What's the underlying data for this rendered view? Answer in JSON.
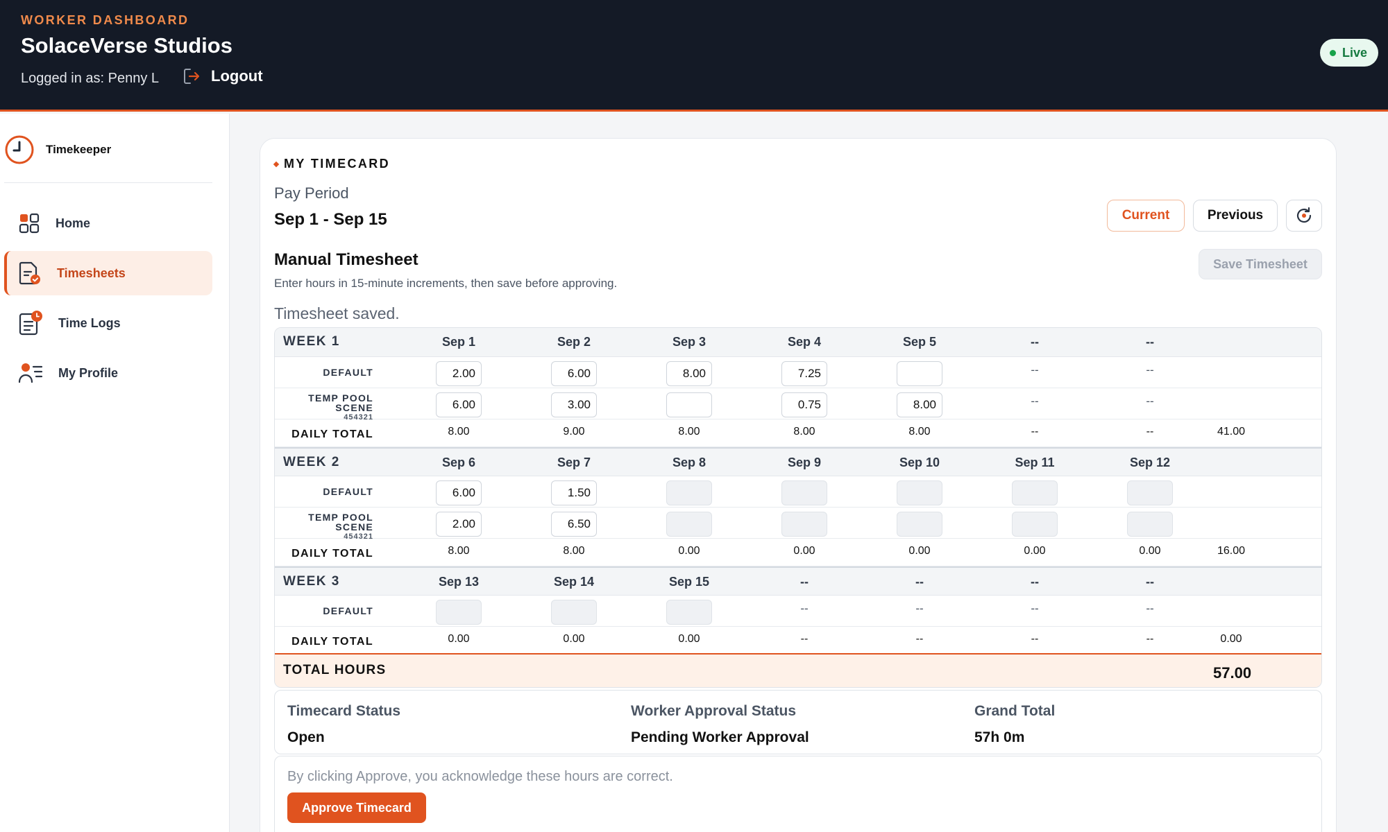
{
  "header": {
    "eyebrow": "WORKER DASHBOARD",
    "title": "SolaceVerse Studios",
    "user_line": "Logged in as: Penny L",
    "logout_label": "Logout",
    "live_label": "Live",
    "colors": {
      "background": "#141a26",
      "accent": "#e0531f",
      "live": "#16a34a"
    }
  },
  "sidebar": {
    "brand": "Timekeeper",
    "items": [
      {
        "label": "Home",
        "icon": "grid-icon",
        "active": false
      },
      {
        "label": "Timesheets",
        "icon": "document-check-icon",
        "active": true
      },
      {
        "label": "Time Logs",
        "icon": "log-clock-icon",
        "active": false
      },
      {
        "label": "My Profile",
        "icon": "user-list-icon",
        "active": false
      }
    ]
  },
  "timecard": {
    "section_label": "MY TIMECARD",
    "pay_period_label": "Pay Period",
    "pay_period_value": "Sep 1 - Sep 15",
    "btn_current": "Current",
    "btn_previous": "Previous",
    "refresh_icon": "refresh-icon",
    "manual_title": "Manual Timesheet",
    "manual_subtitle": "Enter hours in 15-minute increments, then save before approving.",
    "save_label": "Save Timesheet",
    "saved_message": "Timesheet saved."
  },
  "weeks": [
    {
      "label": "WEEK 1",
      "days": [
        "Sep 1",
        "Sep 2",
        "Sep 3",
        "Sep 4",
        "Sep 5",
        "--",
        "--"
      ],
      "rows": [
        {
          "label": "DEFAULT",
          "code": "",
          "cells": [
            {
              "type": "input",
              "value": "2.00"
            },
            {
              "type": "input",
              "value": "6.00"
            },
            {
              "type": "input",
              "value": "8.00"
            },
            {
              "type": "input",
              "value": "7.25"
            },
            {
              "type": "input",
              "value": ""
            },
            {
              "type": "dash",
              "value": "--"
            },
            {
              "type": "dash",
              "value": "--"
            }
          ]
        },
        {
          "label": "TEMP POOL SCENE",
          "code": "454321",
          "cells": [
            {
              "type": "input",
              "value": "6.00"
            },
            {
              "type": "input",
              "value": "3.00"
            },
            {
              "type": "input",
              "value": ""
            },
            {
              "type": "input",
              "value": "0.75"
            },
            {
              "type": "input",
              "value": "8.00"
            },
            {
              "type": "dash",
              "value": "--"
            },
            {
              "type": "dash",
              "value": "--"
            }
          ]
        }
      ],
      "total_label": "DAILY TOTAL",
      "daily_totals": [
        "8.00",
        "9.00",
        "8.00",
        "8.00",
        "8.00",
        "--",
        "--"
      ],
      "week_total": "41.00"
    },
    {
      "label": "WEEK 2",
      "days": [
        "Sep 6",
        "Sep 7",
        "Sep 8",
        "Sep 9",
        "Sep 10",
        "Sep 11",
        "Sep 12"
      ],
      "rows": [
        {
          "label": "DEFAULT",
          "code": "",
          "cells": [
            {
              "type": "input",
              "value": "6.00"
            },
            {
              "type": "input",
              "value": "1.50"
            },
            {
              "type": "disabled",
              "value": ""
            },
            {
              "type": "disabled",
              "value": ""
            },
            {
              "type": "disabled",
              "value": ""
            },
            {
              "type": "disabled",
              "value": ""
            },
            {
              "type": "disabled",
              "value": ""
            }
          ]
        },
        {
          "label": "TEMP POOL SCENE",
          "code": "454321",
          "cells": [
            {
              "type": "input",
              "value": "2.00"
            },
            {
              "type": "input",
              "value": "6.50"
            },
            {
              "type": "disabled",
              "value": ""
            },
            {
              "type": "disabled",
              "value": ""
            },
            {
              "type": "disabled",
              "value": ""
            },
            {
              "type": "disabled",
              "value": ""
            },
            {
              "type": "disabled",
              "value": ""
            }
          ]
        }
      ],
      "total_label": "DAILY TOTAL",
      "daily_totals": [
        "8.00",
        "8.00",
        "0.00",
        "0.00",
        "0.00",
        "0.00",
        "0.00"
      ],
      "week_total": "16.00"
    },
    {
      "label": "WEEK 3",
      "days": [
        "Sep 13",
        "Sep 14",
        "Sep 15",
        "--",
        "--",
        "--",
        "--"
      ],
      "rows": [
        {
          "label": "DEFAULT",
          "code": "",
          "cells": [
            {
              "type": "disabled",
              "value": ""
            },
            {
              "type": "disabled",
              "value": ""
            },
            {
              "type": "disabled",
              "value": ""
            },
            {
              "type": "dash",
              "value": "--"
            },
            {
              "type": "dash",
              "value": "--"
            },
            {
              "type": "dash",
              "value": "--"
            },
            {
              "type": "dash",
              "value": "--"
            }
          ]
        }
      ],
      "total_label": "DAILY TOTAL",
      "daily_totals": [
        "0.00",
        "0.00",
        "0.00",
        "--",
        "--",
        "--",
        "--"
      ],
      "week_total": "0.00"
    }
  ],
  "totals": {
    "label": "TOTAL HOURS",
    "value": "57.00"
  },
  "status": {
    "timecard_label": "Timecard Status",
    "timecard_value": "Open",
    "approval_label": "Worker Approval Status",
    "approval_value": "Pending Worker Approval",
    "grand_label": "Grand Total",
    "grand_value": "57h 0m"
  },
  "approve": {
    "notice": "By clicking Approve, you acknowledge these hours are correct.",
    "button_label": "Approve Timecard"
  }
}
